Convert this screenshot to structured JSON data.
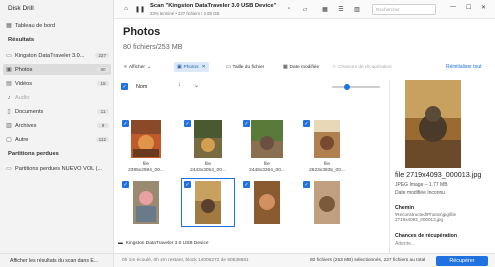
{
  "app_title": "Disk Drill",
  "sidebar": {
    "dashboard": "Tableau de bord",
    "results_section": "Résultats",
    "items": [
      {
        "label": "Kingston DataTraveler 3.0...",
        "count": "227"
      },
      {
        "label": "Photos",
        "count": "80"
      },
      {
        "label": "Vidéos",
        "count": "15"
      },
      {
        "label": "Audio",
        "count": ""
      },
      {
        "label": "Documents",
        "count": "11"
      },
      {
        "label": "Archives",
        "count": "9"
      },
      {
        "label": "Autre",
        "count": "112"
      }
    ],
    "lost_section": "Partitions perdues",
    "lost_item": "Partitions perdues NUEVO VOL (...",
    "footer": "Afficher les résultats du scan dans E..."
  },
  "topbar": {
    "scan_title": "Scan \"Kingston DataTraveler 3.0 USB Device\"",
    "scan_sub": "23% terminé • 227 fichiers / 2.88 GB",
    "search_placeholder": "Rechercher"
  },
  "main": {
    "title": "Photos",
    "subtitle": "80 fichiers/253 MB",
    "filters": {
      "show": "Afficher",
      "photos": "Photos",
      "size": "Taille du fichier",
      "date": "Date modifiée",
      "chances": "Chances de récupération",
      "reset": "Réinitialiser tout"
    },
    "column_name": "Nom",
    "thumbnails": [
      {
        "label1": "file",
        "label2": "2395x2994_00..."
      },
      {
        "label1": "file",
        "label2": "2443x3054_00..."
      },
      {
        "label1": "file",
        "label2": "2448x3264_00..."
      },
      {
        "label1": "file",
        "label2": "2623x3935_00..."
      },
      {
        "label1": "",
        "label2": ""
      },
      {
        "label1": "",
        "label2": ""
      },
      {
        "label1": "",
        "label2": ""
      },
      {
        "label1": "",
        "label2": ""
      }
    ],
    "device_strip": "Kingston DataTraveler 3.0 USB Device"
  },
  "status": {
    "left": "0h 1m écoulé, 0h 4m restant, block 14006272 de 60538881",
    "right": "80 fichiers (253 MB) sélectionnés, 227 fichiers au total",
    "recover": "Récupérer"
  },
  "details": {
    "title": "file 2719x4093_000013.jpg",
    "type": "JPEG Image – 1.77 MB",
    "date": "Date modifiée Inconnu",
    "path_h": "Chemin",
    "path": "\\Reconstructed\\Photos\\jpg\\file 2719x4093_000013.jpg",
    "chances_h": "Chances de récupération",
    "chances": "Attente..."
  },
  "colors": {
    "accent": "#1f72e0",
    "sidebar_bg": "#f3f3f3"
  }
}
